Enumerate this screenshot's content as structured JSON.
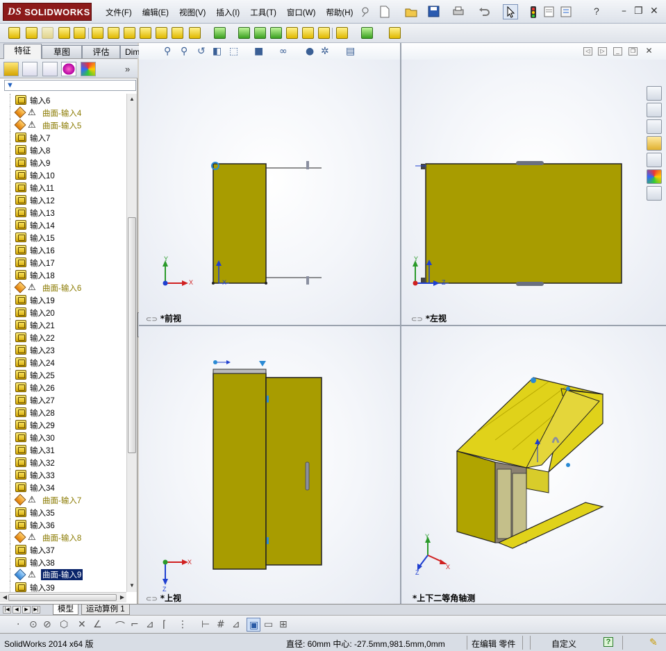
{
  "app": {
    "logo_text": "SOLIDWORKS",
    "logo_prefix": "DS"
  },
  "menu": [
    "文件(F)",
    "编辑(E)",
    "视图(V)",
    "插入(I)",
    "工具(T)",
    "窗口(W)",
    "帮助(H)"
  ],
  "manager_tabs": [
    "特征",
    "草图",
    "评估",
    "DimXpert"
  ],
  "tree": [
    {
      "label": "输入6",
      "type": "import"
    },
    {
      "label": "曲面-输入4",
      "type": "surface-warn"
    },
    {
      "label": "曲面-输入5",
      "type": "surface-warn"
    },
    {
      "label": "输入7",
      "type": "import"
    },
    {
      "label": "输入8",
      "type": "import"
    },
    {
      "label": "输入9",
      "type": "import"
    },
    {
      "label": "输入10",
      "type": "import"
    },
    {
      "label": "输入11",
      "type": "import"
    },
    {
      "label": "输入12",
      "type": "import"
    },
    {
      "label": "输入13",
      "type": "import"
    },
    {
      "label": "输入14",
      "type": "import"
    },
    {
      "label": "输入15",
      "type": "import"
    },
    {
      "label": "输入16",
      "type": "import"
    },
    {
      "label": "输入17",
      "type": "import"
    },
    {
      "label": "输入18",
      "type": "import"
    },
    {
      "label": "曲面-输入6",
      "type": "surface-warn"
    },
    {
      "label": "输入19",
      "type": "import"
    },
    {
      "label": "输入20",
      "type": "import"
    },
    {
      "label": "输入21",
      "type": "import"
    },
    {
      "label": "输入22",
      "type": "import"
    },
    {
      "label": "输入23",
      "type": "import"
    },
    {
      "label": "输入24",
      "type": "import"
    },
    {
      "label": "输入25",
      "type": "import"
    },
    {
      "label": "输入26",
      "type": "import"
    },
    {
      "label": "输入27",
      "type": "import"
    },
    {
      "label": "输入28",
      "type": "import"
    },
    {
      "label": "输入29",
      "type": "import"
    },
    {
      "label": "输入30",
      "type": "import"
    },
    {
      "label": "输入31",
      "type": "import"
    },
    {
      "label": "输入32",
      "type": "import"
    },
    {
      "label": "输入33",
      "type": "import"
    },
    {
      "label": "输入34",
      "type": "import"
    },
    {
      "label": "曲面-输入7",
      "type": "surface-warn"
    },
    {
      "label": "输入35",
      "type": "import"
    },
    {
      "label": "输入36",
      "type": "import"
    },
    {
      "label": "曲面-输入8",
      "type": "surface-warn"
    },
    {
      "label": "输入37",
      "type": "import"
    },
    {
      "label": "输入38",
      "type": "import"
    },
    {
      "label": "曲面-输入9",
      "type": "surface-warn",
      "selected": true
    },
    {
      "label": "输入39",
      "type": "import"
    }
  ],
  "viewports": {
    "front": "*前视",
    "left": "*左视",
    "top": "*上视",
    "iso": "*上下二等角轴测"
  },
  "axis_labels": {
    "x": "X",
    "y": "Y",
    "z": "Z"
  },
  "bottom_tabs": [
    "模型",
    "运动算例 1"
  ],
  "status": {
    "version": "SolidWorks 2014 x64 版",
    "measure": "直径: 60mm  中心: -27.5mm,981.5mm,0mm",
    "mode": "在编辑 零件",
    "custom": "自定义",
    "help": "?"
  },
  "colors": {
    "model_fill": "#a89c00",
    "model_light": "#e0d21a",
    "selection": "#0a246a",
    "logo_bg": "#8c1a1a"
  }
}
